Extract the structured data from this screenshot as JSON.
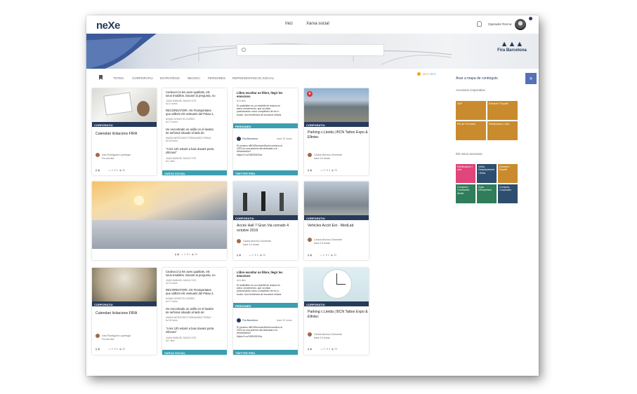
{
  "topbar": {
    "logo": "neXe",
    "nav": [
      "Inici",
      "Xarxa social"
    ],
    "user": "Operador Recna"
  },
  "banner": {
    "search_placeholder": "",
    "brand": "Fira Barcelona"
  },
  "filters": [
    "TOTES",
    "CORPORATIU",
    "ESTRATÈGIC",
    "NEGOCI",
    "PERSONES",
    "REPRESENTANCIO SOCIAL"
  ],
  "weather": {
    "a": "20°C",
    "b": "25°C"
  },
  "side": {
    "link": "Anar a mapa de continguts",
    "button": "»",
    "corp_title": "Accessos corporatius",
    "corp_tiles": [
      "SAP",
      "Extranet / Expofil",
      "Pla de Formació",
      "Retribucions i otra"
    ],
    "more_title": "Els meus accessos",
    "more_tiles": [
      "Retribucions i otra",
      "Vetlla, Desplaçament i Dieta",
      "Extranet / Expofil",
      "Compres i Contractes Àmbit",
      "Guia d’Empreses",
      "Compres Corporatiu"
    ]
  },
  "cards": [
    {
      "cat": "CORPORATIU",
      "title": "Calendari licitacions FIRA",
      "author": "Xavi Rodriguez Lopetegui",
      "date": "Fa una dia"
    },
    {
      "lines": [
        "Cedexcci la les aves qualitats, els",
        "seus treabllos. Davant la pregunta, no"
      ],
      "a1": "JUAN MANUEL MACIA YOS",
      "d1": "fa 11 hores",
      "t2": [
        "RECORDATORI: Als FiraSportates",
        "que utilitzin els vestuaris del Palau 2,"
      ],
      "a2": "NOMA CERAFITA GORRIZ",
      "d2": "fa 17 hores",
      "t3": [
        "He encontrado un anillo en el lavabo",
        "de señoras situado al lado de"
      ],
      "a3": "MARIA MERCEDES FERNANDEZ PARAS",
      "d3": "fa 18 hores",
      "t4": [
        "\"A les 12h estarè a baix davant porta",
        "oficines\""
      ],
      "a4": "JUAN MANUEL MACIA YOS",
      "d4": "fa 1 dies",
      "foot": "XARXA SOCIAL"
    },
    {
      "t1": [
        "Llibre escoltar un llibre, llegir les",
        "emocions"
      ],
      "d1": "fa 6 dies",
      "body": [
        "El audiollibre es un modèlle de lectura en",
        "pleno creciemento, que va estar",
        "posicionando como competidor de los e-",
        "books. Una tendencia de escuchar relatos"
      ],
      "band": "PERSONES",
      "acct": "Fira Barcelona",
      "when": "hace 19 horas",
      "tweet": [
        "El proximo #BCNSummerWorld comienz la",
        "2022 es una primera dia dedicada a la",
        "#HotelsWord",
        "https://t.co/128030DXbz"
      ],
      "foot": "TWITTER FIRA"
    },
    {
      "cat": "CORPORATIU",
      "title": "Parking c.Lleida | BCN Tattoo Expo & Efintec",
      "author": "Carlos Moreno Clemente",
      "date": "hace 19 horas"
    },
    {
      "counts": [
        "3",
        "1",
        "25"
      ]
    },
    {
      "cat": "CORPORATIU",
      "title": "Accés Hall 7 Gran Via cerrado 4 octubre 2019",
      "author": "Carlos Moreno Clemente",
      "date": "hace 19 horas"
    },
    {
      "cat": "CORPORATIU",
      "title": "Vehicles Acció Ext - MedLab",
      "author": "Carlos Moreno Clemente",
      "date": "hace 19 horas"
    },
    {
      "cat": "CORPORATIU",
      "title": "Calendari licitacions FIRA",
      "author": "Xavi Rodriguez Lopetegui",
      "date": "Fa una dia"
    },
    {
      "foot": "XARXA SOCIAL"
    },
    {
      "foot": "TWITTER FIRA",
      "band": "PERSONES"
    },
    {
      "cat": "CORPORATIU",
      "title": "Parking c.Lleida | BCN Tattoo Expo & Efintec",
      "author": "Carlos Moreno Clemente",
      "date": "hace 19 horas"
    }
  ],
  "counts": {
    "a": "0",
    "b": "4",
    "c": "25"
  }
}
